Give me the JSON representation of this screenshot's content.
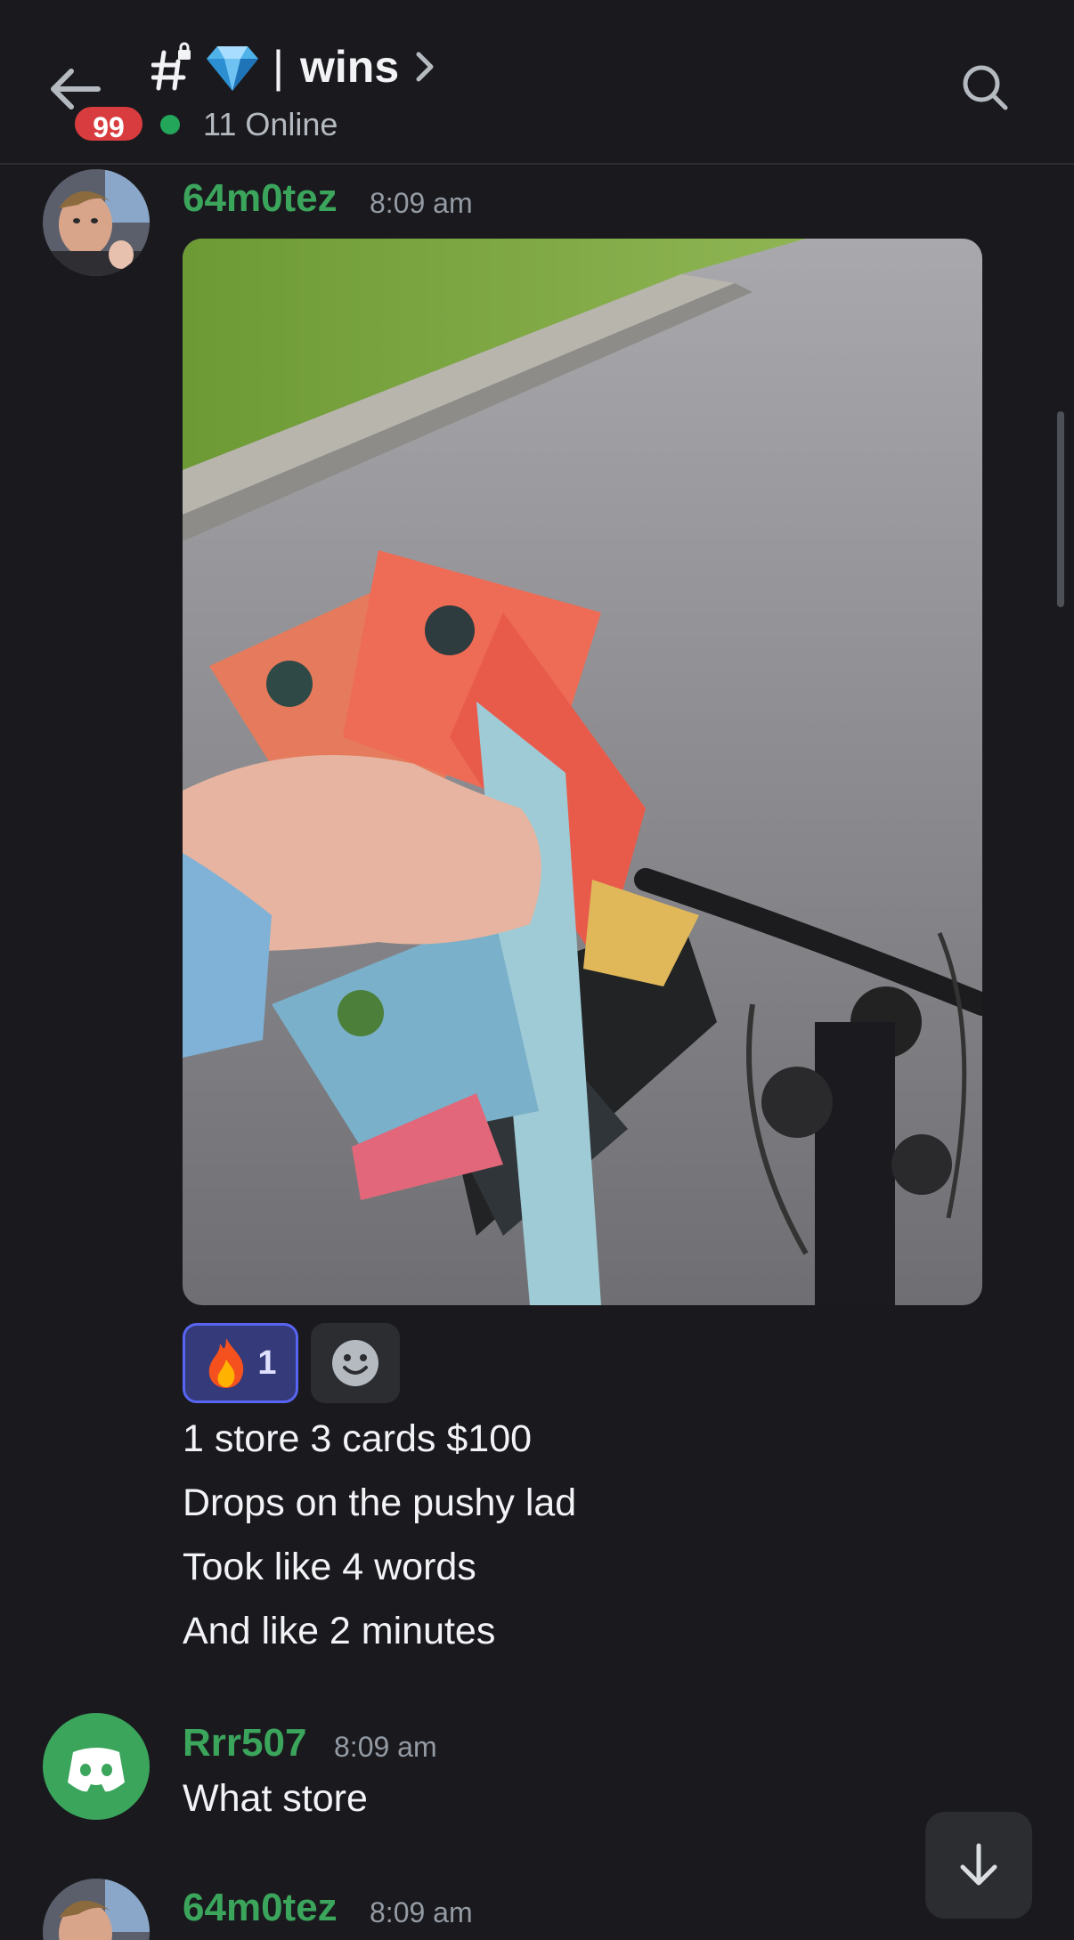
{
  "header": {
    "channel_emoji": "💎",
    "separator": "|",
    "channel_name": "wins",
    "unread_count": "99",
    "online_text": "11 Online"
  },
  "messages": [
    {
      "author": "64m0tez",
      "time": "8:09 am",
      "reaction": {
        "emoji": "🔥",
        "count": "1"
      },
      "lines": [
        "1 store 3 cards $100",
        "Drops on the pushy lad",
        "Took like 4 words",
        "And like 2 minutes"
      ]
    },
    {
      "author": "Rrr507",
      "time": "8:09 am",
      "lines": [
        "What store"
      ]
    },
    {
      "author": "64m0tez",
      "time": "8:09 am"
    }
  ],
  "icons": {
    "back": "arrow-left-icon",
    "search": "search-icon",
    "add_reaction": "smiley-icon",
    "scroll_bottom": "arrow-down-icon",
    "avatar_discord": "discord-logo-icon"
  },
  "colors": {
    "background": "#1a1a1e",
    "username_green": "#3ba55c",
    "badge_red": "#d83c3e",
    "online_green": "#23a55a",
    "reaction_accent": "#5865f2"
  }
}
